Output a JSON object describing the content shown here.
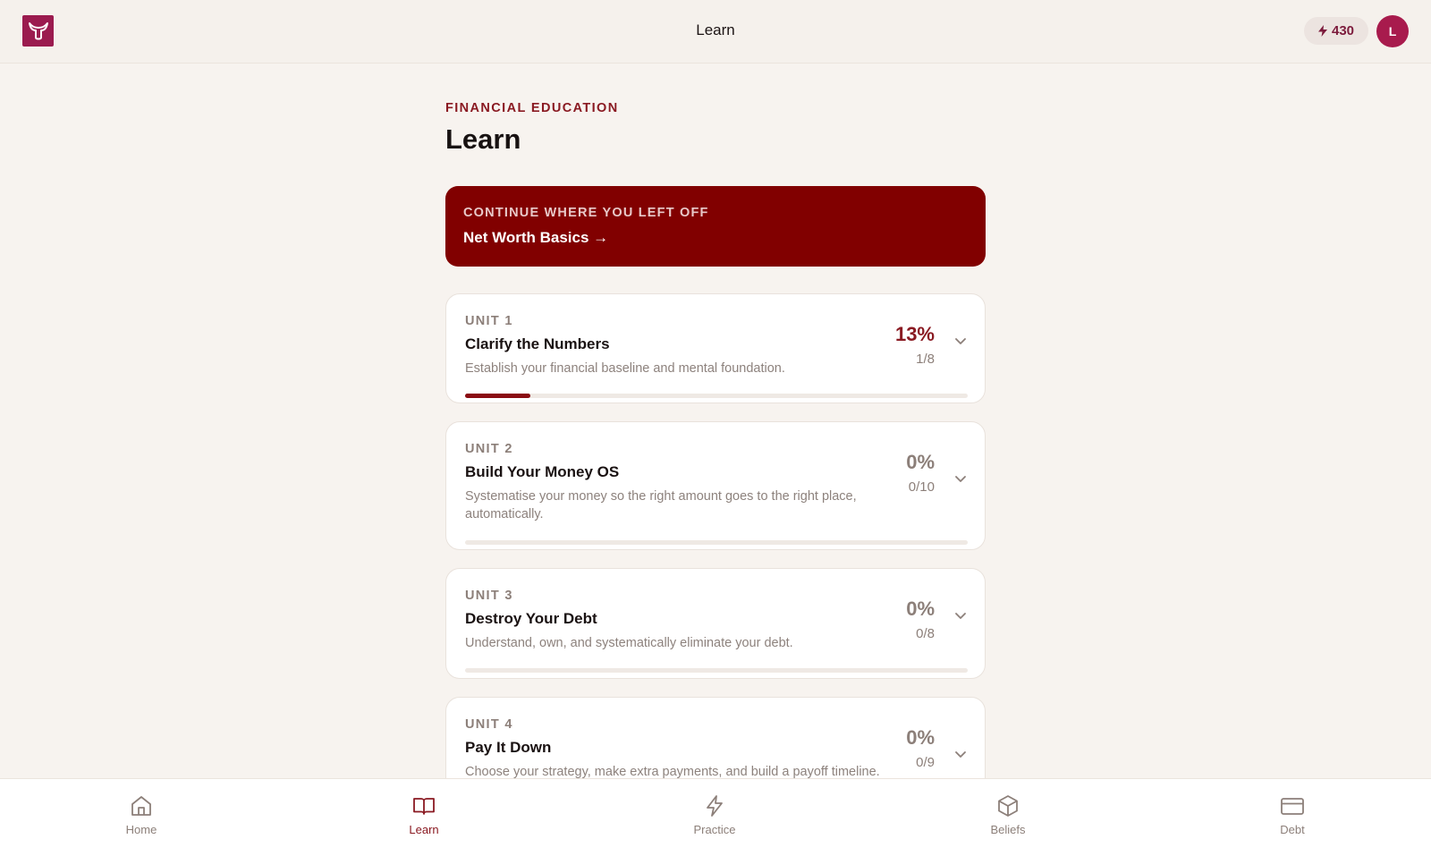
{
  "header": {
    "title": "Learn",
    "logo_icon": "bull-logo-icon",
    "xp_icon": "bolt-icon",
    "xp_value": "430",
    "avatar_initial": "L"
  },
  "page": {
    "eyebrow": "FINANCIAL EDUCATION",
    "title": "Learn"
  },
  "continue": {
    "eyebrow": "CONTINUE WHERE YOU LEFT OFF",
    "title": "Net Worth Basics →"
  },
  "units": [
    {
      "label": "UNIT 1",
      "title": "Clarify the Numbers",
      "description": "Establish your financial baseline and mental foundation.",
      "percent": "13%",
      "count": "1/8",
      "progress": 0.13
    },
    {
      "label": "UNIT 2",
      "title": "Build Your Money OS",
      "description": "Systematise your money so the right amount goes to the right place, automatically.",
      "percent": "0%",
      "count": "0/10",
      "progress": 0
    },
    {
      "label": "UNIT 3",
      "title": "Destroy Your Debt",
      "description": "Understand, own, and systematically eliminate your debt.",
      "percent": "0%",
      "count": "0/8",
      "progress": 0
    },
    {
      "label": "UNIT 4",
      "title": "Pay It Down",
      "description": "Choose your strategy, make extra payments, and build a payoff timeline.",
      "percent": "0%",
      "count": "0/9",
      "progress": 0
    }
  ],
  "nav": {
    "items": [
      {
        "label": "Home",
        "icon": "home-icon"
      },
      {
        "label": "Learn",
        "icon": "book-icon",
        "active": true
      },
      {
        "label": "Practice",
        "icon": "bolt-icon"
      },
      {
        "label": "Beliefs",
        "icon": "cube-icon"
      },
      {
        "label": "Debt",
        "icon": "credit-card-icon"
      }
    ]
  },
  "colors": {
    "brand": "#810000",
    "accent": "#8a1a22",
    "logo": "#9b1b4f",
    "background": "#f7f3ef"
  }
}
